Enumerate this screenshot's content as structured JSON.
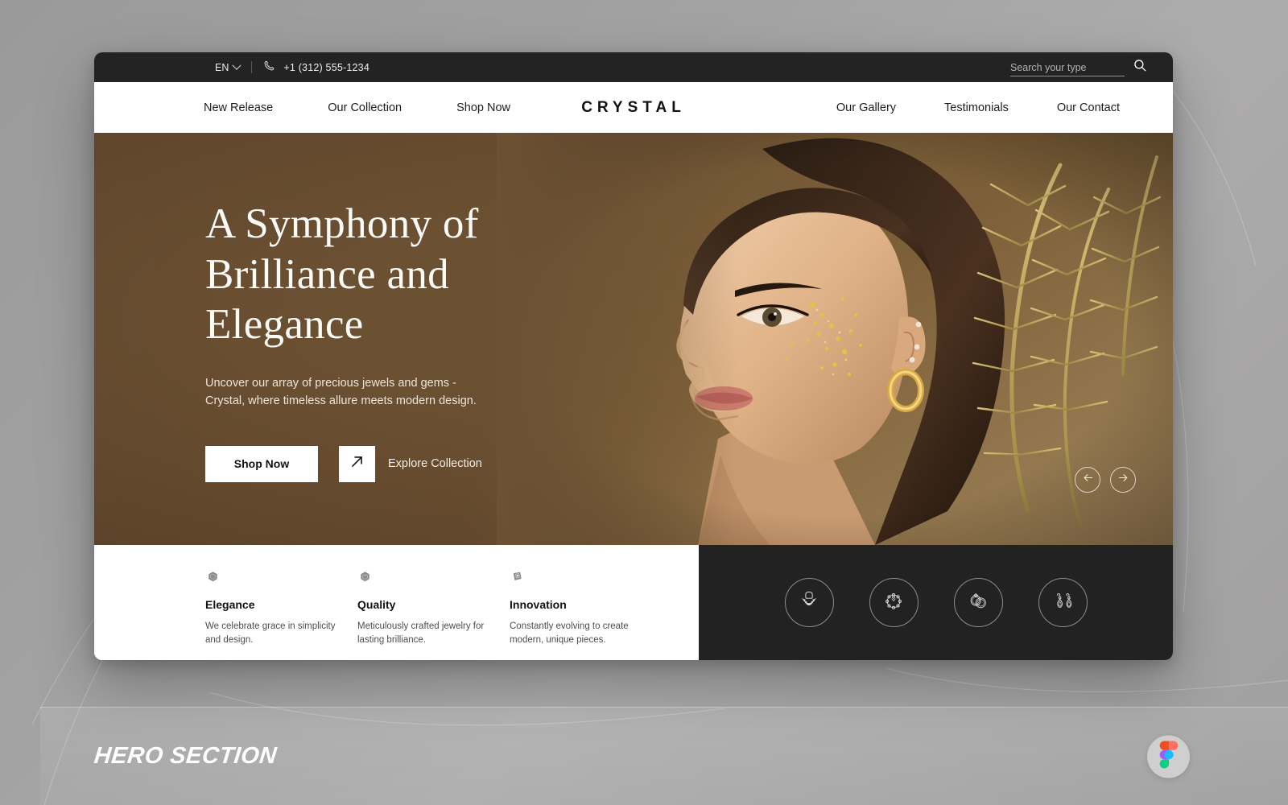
{
  "topbar": {
    "language": "EN",
    "language_icon": "chevron-down-icon",
    "phone_icon": "phone-icon",
    "phone": "+1 (312) 555-1234",
    "search_placeholder": "Search your type",
    "search_value": "",
    "search_icon": "search-icon",
    "background_color": "#232323"
  },
  "nav": {
    "brand": "CRYSTAL",
    "left_links": [
      {
        "label": "New Release"
      },
      {
        "label": "Our Collection"
      },
      {
        "label": "Shop Now"
      }
    ],
    "right_links": [
      {
        "label": "Our Gallery"
      },
      {
        "label": "Testimonials"
      },
      {
        "label": "Our Contact"
      }
    ]
  },
  "hero": {
    "title_lines": [
      "A Symphony of",
      "Brilliance and",
      "Elegance"
    ],
    "title": "A Symphony of Brilliance and Elegance",
    "subtitle": "Uncover our array of precious jewels and gems - Crystal, where timeless allure meets modern design.",
    "primary_button": "Shop Now",
    "secondary_button": "Explore Collection",
    "secondary_icon": "arrow-up-right-icon",
    "prev_icon": "arrow-left-icon",
    "next_icon": "arrow-right-icon",
    "background_color": "#6e5234"
  },
  "features": [
    {
      "icon": "gem-elegance-icon",
      "title": "Elegance",
      "description": "We celebrate grace in simplicity and design."
    },
    {
      "icon": "gem-quality-icon",
      "title": "Quality",
      "description": "Meticulously crafted jewelry for lasting brilliance."
    },
    {
      "icon": "gem-innovation-icon",
      "title": "Innovation",
      "description": "Constantly evolving to create modern, unique pieces."
    }
  ],
  "categories": {
    "background_color": "#222222",
    "items": [
      {
        "icon": "necklace-icon",
        "label": "Necklace"
      },
      {
        "icon": "bracelet-icon",
        "label": "Bracelet"
      },
      {
        "icon": "rings-icon",
        "label": "Rings"
      },
      {
        "icon": "earrings-icon",
        "label": "Earrings"
      }
    ]
  },
  "caption": {
    "text": "HERO SECTION",
    "badge_icon": "figma-logo-icon"
  }
}
